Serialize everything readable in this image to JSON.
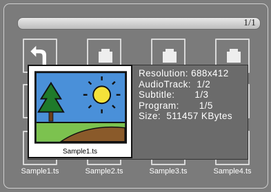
{
  "header": {
    "page_indicator": "1/1"
  },
  "files": [
    {
      "name": "Sample1.ts"
    },
    {
      "name": "Sample2.ts"
    },
    {
      "name": "Sample3.ts"
    },
    {
      "name": "Sample4.ts"
    }
  ],
  "preview": {
    "caption": "Sample1.ts",
    "info": {
      "resolution": "Resolution: 688x412",
      "audio_track": "AudioTrack:  1/2",
      "subtitle": "Subtitle:       1/3",
      "program": "Program:       1/5",
      "size": "Size:  511457 KBytes"
    }
  },
  "colors": {
    "background": "#7d7d7d",
    "sky": "#4a90d9",
    "grass": "#7cc24f",
    "sun": "#f5e23a",
    "tree": "#1f7a2a"
  }
}
